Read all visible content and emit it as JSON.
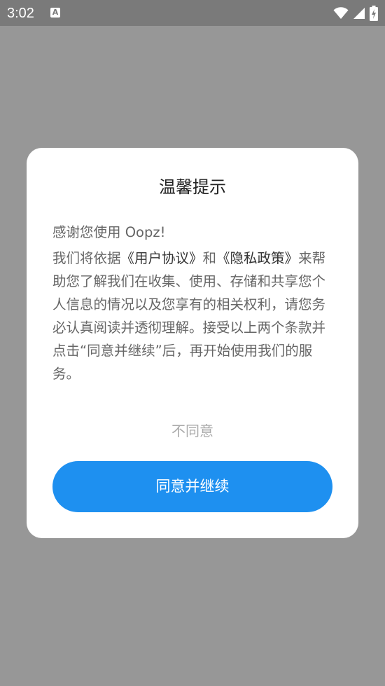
{
  "status_bar": {
    "time": "3:02",
    "notification_icon": "keyboard-a-icon",
    "wifi_icon": "wifi-icon",
    "signal_icon": "cell-signal-icon",
    "battery_icon": "battery-charging-icon"
  },
  "dialog": {
    "title": "温馨提示",
    "greeting": "感谢您使用 Oopz!",
    "body": {
      "part1": "我们将依据",
      "user_agreement_link": "《用户协议》",
      "part2": "和",
      "privacy_policy_link": "《隐私政策》",
      "part3": "来帮助您了解我们在收集、使用、存储和共享您个人信息的情况以及您享有的相关权利，请您务必认真阅读并透彻理解。接受以上两个条款并点击“同意并继续”后，再开始使用我们的服务。"
    },
    "disagree_label": "不同意",
    "agree_label": "同意并继续"
  },
  "colors": {
    "overlay": "#979797",
    "status_bar": "#7a7a7a",
    "primary": "#1e90f0",
    "body_text": "#666666",
    "link_text": "#333333",
    "muted_text": "#aaaaaa"
  }
}
